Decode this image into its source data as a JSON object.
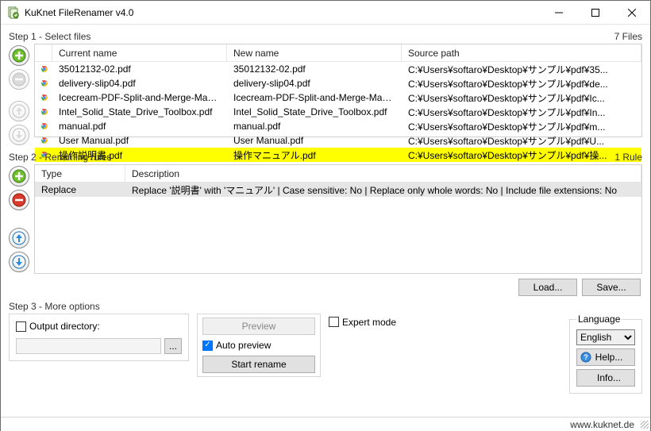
{
  "window": {
    "title": "KuKnet FileRenamer v4.0"
  },
  "step1": {
    "label": "Step 1 - Select files",
    "count_label": "7 Files",
    "columns": {
      "icon": "",
      "current": "Current name",
      "newname": "New name",
      "source": "Source path"
    },
    "files": [
      {
        "current": "35012132-02.pdf",
        "newname": "35012132-02.pdf",
        "source": "C:¥Users¥softaro¥Desktop¥サンプル¥pdf¥35...",
        "hl": false
      },
      {
        "current": "delivery-slip04.pdf",
        "newname": "delivery-slip04.pdf",
        "source": "C:¥Users¥softaro¥Desktop¥サンプル¥pdf¥de...",
        "hl": false
      },
      {
        "current": "Icecream-PDF-Split-and-Merge-Manual...",
        "newname": "Icecream-PDF-Split-and-Merge-Manual...",
        "source": "C:¥Users¥softaro¥Desktop¥サンプル¥pdf¥Ic...",
        "hl": false
      },
      {
        "current": "Intel_Solid_State_Drive_Toolbox.pdf",
        "newname": "Intel_Solid_State_Drive_Toolbox.pdf",
        "source": "C:¥Users¥softaro¥Desktop¥サンプル¥pdf¥In...",
        "hl": false
      },
      {
        "current": "manual.pdf",
        "newname": "manual.pdf",
        "source": "C:¥Users¥softaro¥Desktop¥サンプル¥pdf¥m...",
        "hl": false
      },
      {
        "current": "User Manual.pdf",
        "newname": "User Manual.pdf",
        "source": "C:¥Users¥softaro¥Desktop¥サンプル¥pdf¥U...",
        "hl": false
      },
      {
        "current": "操作説明書.pdf",
        "newname": "操作マニュアル.pdf",
        "source": "C:¥Users¥softaro¥Desktop¥サンプル¥pdf¥操...",
        "hl": true
      }
    ]
  },
  "step2": {
    "label": "Step 2 - Renaming rules",
    "count_label": "1 Rule",
    "columns": {
      "type": "Type",
      "desc": "Description"
    },
    "rules": [
      {
        "type": "Replace",
        "desc": "Replace '説明書' with 'マニュアル' | Case sensitive: No | Replace only whole words: No | Include file extensions: No"
      }
    ],
    "load_label": "Load...",
    "save_label": "Save..."
  },
  "step3": {
    "label": "Step 3 - More options",
    "output_dir_label": "Output directory:",
    "output_dir_value": "",
    "browse_label": "...",
    "preview_label": "Preview",
    "auto_preview_label": "Auto preview",
    "auto_preview_checked": true,
    "start_label": "Start rename",
    "expert_label": "Expert mode",
    "expert_checked": false,
    "language_legend": "Language",
    "language_value": "English",
    "help_label": "Help...",
    "info_label": "Info..."
  },
  "statusbar": {
    "url": "www.kuknet.de"
  }
}
